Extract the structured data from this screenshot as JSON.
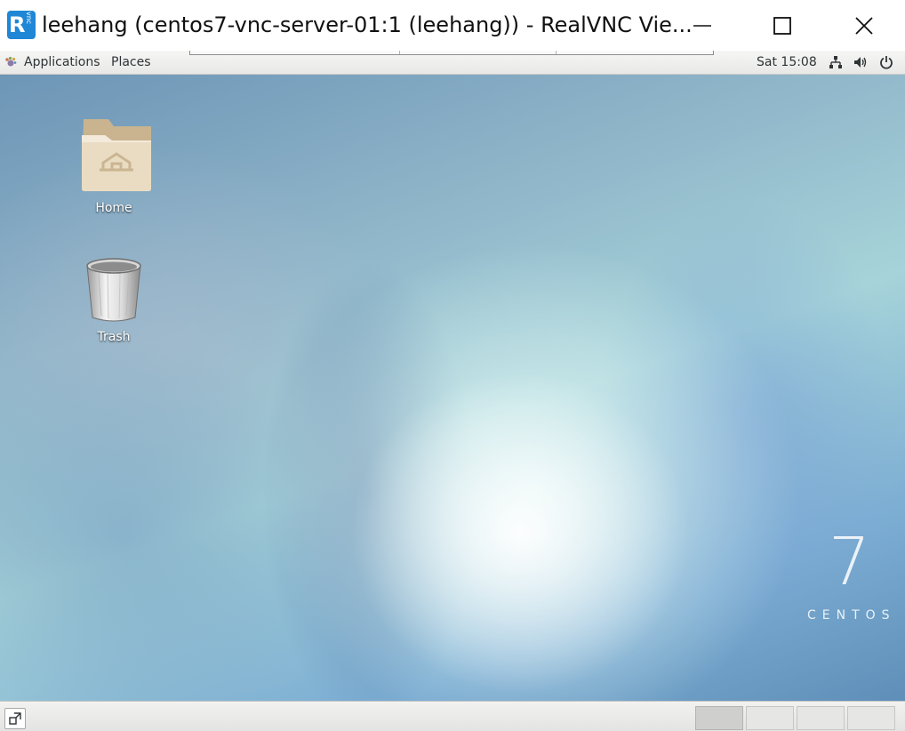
{
  "window": {
    "logo_letter": "R",
    "logo_sub": "vnc",
    "title": "leehang (centos7-vnc-server-01:1 (leehang)) - RealVNC Vie..."
  },
  "topbar": {
    "applications_label": "Applications",
    "places_label": "Places",
    "clock": "Sat 15:08"
  },
  "desktop": {
    "icons": [
      {
        "label": "Home",
        "icon": "home-folder-icon"
      },
      {
        "label": "Trash",
        "icon": "trash-can-icon"
      }
    ],
    "brand_number": "7",
    "brand_name": "CENTOS"
  },
  "bottombar": {
    "workspaces": 4,
    "active_workspace": 1
  },
  "colors": {
    "vnc_blue": "#1f87d6",
    "folder": "#e8d7bb"
  }
}
